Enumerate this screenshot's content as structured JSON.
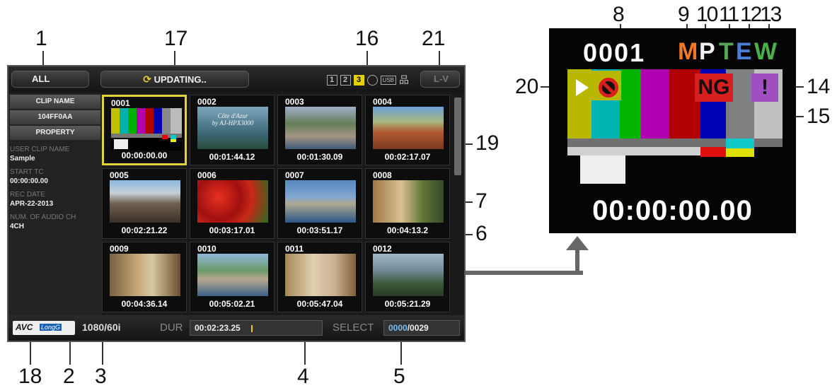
{
  "callouts": [
    "1",
    "2",
    "3",
    "4",
    "5",
    "6",
    "7",
    "8",
    "9",
    "10",
    "11",
    "12",
    "13",
    "14",
    "15",
    "16",
    "17",
    "18",
    "19",
    "20",
    "21"
  ],
  "topbar": {
    "filter_label": "ALL",
    "status_label": "UPDATING..",
    "slots": [
      "1",
      "2",
      "3"
    ],
    "usb_label": "USB",
    "right_label": "L-V"
  },
  "sidebar": {
    "clip_name_header": "CLIP NAME",
    "clip_name_value": "104FF0AA",
    "property_header": "PROPERTY",
    "fields": [
      {
        "label": "USER CLIP NAME",
        "value": "Sample"
      },
      {
        "label": "START TC",
        "value": "00:00:00.00"
      },
      {
        "label": "REC DATE",
        "value": "APR-22-2013"
      },
      {
        "label": "NUM. OF AUDIO CH",
        "value": "4CH"
      }
    ]
  },
  "clips": [
    {
      "num": "0001",
      "tc": "00:00:00.00"
    },
    {
      "num": "0002",
      "tc": "00:01:44.12",
      "overlay": "Côte d'Azur\nby AJ-HPX3000"
    },
    {
      "num": "0003",
      "tc": "00:01:30.09"
    },
    {
      "num": "0004",
      "tc": "00:02:17.07"
    },
    {
      "num": "0005",
      "tc": "00:02:21.22"
    },
    {
      "num": "0006",
      "tc": "00:03:17.01"
    },
    {
      "num": "0007",
      "tc": "00:03:51.17"
    },
    {
      "num": "0008",
      "tc": "00:04:13.2"
    },
    {
      "num": "0009",
      "tc": "00:04:36.14"
    },
    {
      "num": "0010",
      "tc": "00:05:02.21"
    },
    {
      "num": "0011",
      "tc": "00:05:47.04"
    },
    {
      "num": "0012",
      "tc": "00:05:21.29"
    }
  ],
  "bottombar": {
    "codec_label": "AVC",
    "codec_sub": "LongG",
    "format": "1080/60i",
    "dur_label": "DUR",
    "dur_value": "00:02:23.25",
    "select_label": "SELECT",
    "select_current": "0000",
    "select_total": "/0029"
  },
  "zoom": {
    "clip_num": "0001",
    "flag_m": "M",
    "flag_p": "P",
    "flag_t": "T",
    "flag_e": "E",
    "flag_w": "W",
    "ng_label": "NG",
    "warn_label": "!",
    "timecode": "00:00:00.00"
  },
  "colors": {
    "selected_border": "#e5d23a",
    "slot_active": "#e6d000",
    "flag_m": "#f07a23",
    "flag_t": "#5aa35a",
    "flag_e": "#4a7ed6",
    "flag_w": "#4ab04a",
    "ng_bg": "#d81e1e",
    "warn_bg": "#a04ec0"
  }
}
